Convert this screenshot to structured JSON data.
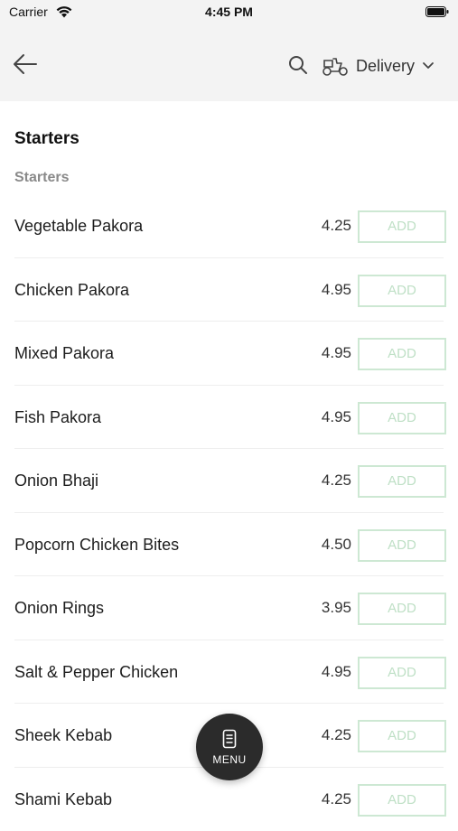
{
  "status_bar": {
    "carrier": "Carrier",
    "time": "4:45 PM",
    "icons": [
      "wifi-icon",
      "battery-icon"
    ]
  },
  "header": {
    "back_icon": "back-arrow-icon",
    "search_icon": "search-icon",
    "order_mode_icon": "scooter-icon",
    "order_mode": "Delivery",
    "order_mode_chevron": "chevron-down-icon"
  },
  "section": {
    "title": "Starters",
    "subtitle": "Starters"
  },
  "items": [
    {
      "name": "Vegetable Pakora",
      "price": "4.25",
      "action": "ADD"
    },
    {
      "name": "Chicken Pakora",
      "price": "4.95",
      "action": "ADD"
    },
    {
      "name": "Mixed Pakora",
      "price": "4.95",
      "action": "ADD"
    },
    {
      "name": "Fish Pakora",
      "price": "4.95",
      "action": "ADD"
    },
    {
      "name": "Onion Bhaji",
      "price": "4.25",
      "action": "ADD"
    },
    {
      "name": "Popcorn Chicken Bites",
      "price": "4.50",
      "action": "ADD"
    },
    {
      "name": "Onion Rings",
      "price": "3.95",
      "action": "ADD"
    },
    {
      "name": "Salt & Pepper Chicken",
      "price": "4.95",
      "action": "ADD"
    },
    {
      "name": "Sheek Kebab",
      "price": "4.25",
      "action": "ADD"
    },
    {
      "name": "Shami Kebab",
      "price": "4.25",
      "action": "ADD"
    }
  ],
  "fab": {
    "label": "MENU",
    "icon": "menu-card-icon"
  },
  "colors": {
    "header_bg": "#f3f3f3",
    "add_border": "#cde8d3",
    "add_text": "#bfe0c6",
    "fab_bg": "#2b2b2b"
  }
}
